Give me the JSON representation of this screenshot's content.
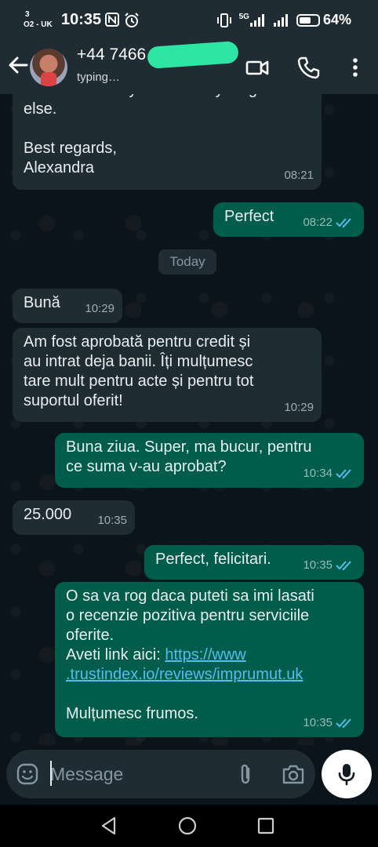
{
  "status_bar": {
    "carrier_top": "3",
    "carrier_bottom": "O2 - UK",
    "time": "10:35",
    "network": "5G",
    "battery": "64%",
    "battery_level": 0.64
  },
  "header": {
    "contact_name": "+44 7466",
    "contact_status": "typing…",
    "icons": [
      "back-arrow-icon",
      "video-call-icon",
      "voice-call-icon",
      "more-vertical-icon"
    ]
  },
  "chat": {
    "date_separator": "Today",
    "messages": [
      {
        "dir": "in",
        "text": "Let me know if you need anything\nelse.\n\nBest regards,\nAlexandra",
        "time": "08:21"
      },
      {
        "dir": "out",
        "text": "Perfect",
        "time": "08:22",
        "read": true
      },
      {
        "dir": "in",
        "text": "Bună",
        "time": "10:29"
      },
      {
        "dir": "in",
        "text": "Am fost aprobată pentru credit și\nau intrat deja banii. Îți mulțumesc\ntare mult pentru acte și pentru tot\nsuportul oferit!",
        "time": "10:29"
      },
      {
        "dir": "out",
        "text": "Buna ziua. Super, ma bucur, pentru\nce suma v-au aprobat?",
        "time": "10:34",
        "read": true
      },
      {
        "dir": "in",
        "text": "25.000",
        "time": "10:35"
      },
      {
        "dir": "out",
        "text": "Perfect, felicitari.",
        "time": "10:35",
        "read": true
      },
      {
        "dir": "out",
        "text_before_link": "O sa va rog daca puteti sa imi lasati\no recenzie pozitiva pentru serviciile\noferite.\nAveti link aici: ",
        "link": "https://www\n.trustindex.io/reviews/imprumut.uk",
        "text_after_link": "\n\nMulțumesc frumos.",
        "time": "10:35",
        "read": true
      }
    ]
  },
  "input": {
    "placeholder": "Message",
    "value": ""
  },
  "colors": {
    "background": "#0b141a",
    "bar": "#1f2c34",
    "incoming_bubble": "#1f2c34",
    "outgoing_bubble": "#005c4b",
    "read_ticks": "#53bdeb",
    "link": "#53bdeb"
  }
}
